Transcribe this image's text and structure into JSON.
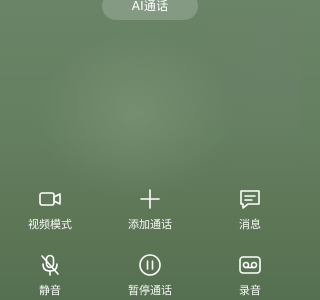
{
  "top_pill": {
    "label": "AI通话"
  },
  "controls": [
    {
      "label": "视频模式",
      "icon": "video-camera-icon"
    },
    {
      "label": "添加通话",
      "icon": "plus-icon"
    },
    {
      "label": "消息",
      "icon": "message-icon"
    },
    {
      "label": "静音",
      "icon": "microphone-muted-icon"
    },
    {
      "label": "暂停通话",
      "icon": "pause-icon"
    },
    {
      "label": "录音",
      "icon": "voicemail-record-icon"
    }
  ]
}
